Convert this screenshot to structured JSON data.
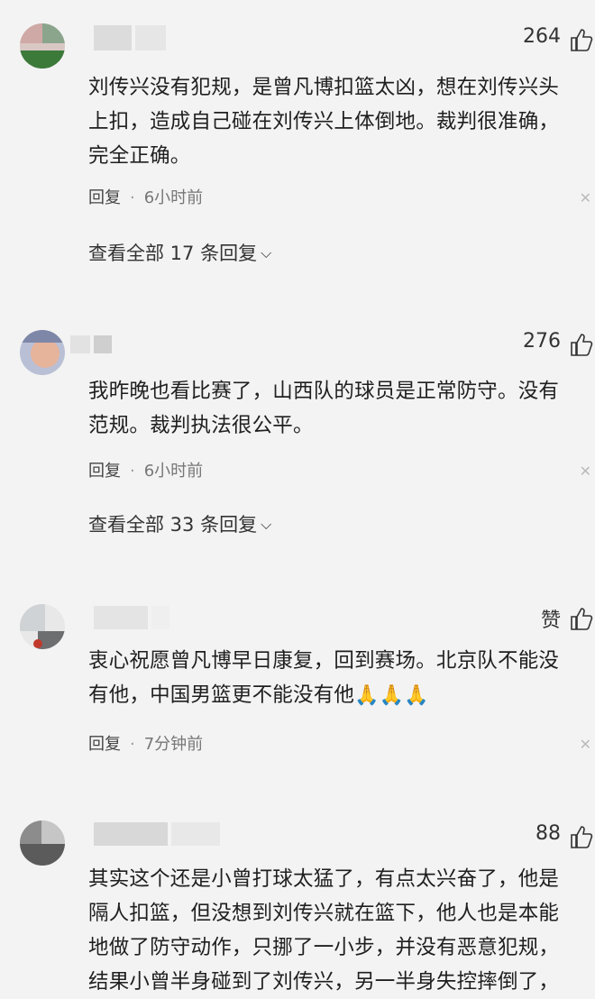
{
  "comments": [
    {
      "likes": "264",
      "text": "刘传兴没有犯规，是曾凡博扣篮太凶，想在刘传兴头\n上扣，造成自己碰在刘传兴上体倒地。裁判很准确，\n完全正确。",
      "reply_label": "回复",
      "time": "6小时前",
      "more": "查看全部 17 条回复"
    },
    {
      "likes": "276",
      "text": "我昨晚也看比赛了，山西队的球员是正常防守。没有\n范规。裁判执法很公平。",
      "reply_label": "回复",
      "time": "6小时前",
      "more": "查看全部 33 条回复"
    },
    {
      "likes": "赞",
      "text": "衷心祝愿曾凡博早日康复，回到赛场。北京队不能没\n有他，中国男篮更不能没有他",
      "emoji": "🙏🙏🙏",
      "reply_label": "回复",
      "time": "7分钟前"
    },
    {
      "likes": "88",
      "text": "其实这个还是小曾打球太猛了，有点太兴奋了，他是\n隔人扣篮，但没想到刘传兴就在篮下，他人也是本能\n地做了防守动作，只挪了一小步，并没有恶意犯规，\n结果小曾半身碰到了刘传兴，另一半身失控摔倒了，"
    }
  ],
  "icons": {
    "thumb": "thumbs-up-icon",
    "chevron": "chevron-down-icon",
    "close": "close-icon"
  },
  "colors": {
    "background": "#f3f3f3",
    "text": "#1f1f1f",
    "meta": "#777777"
  }
}
